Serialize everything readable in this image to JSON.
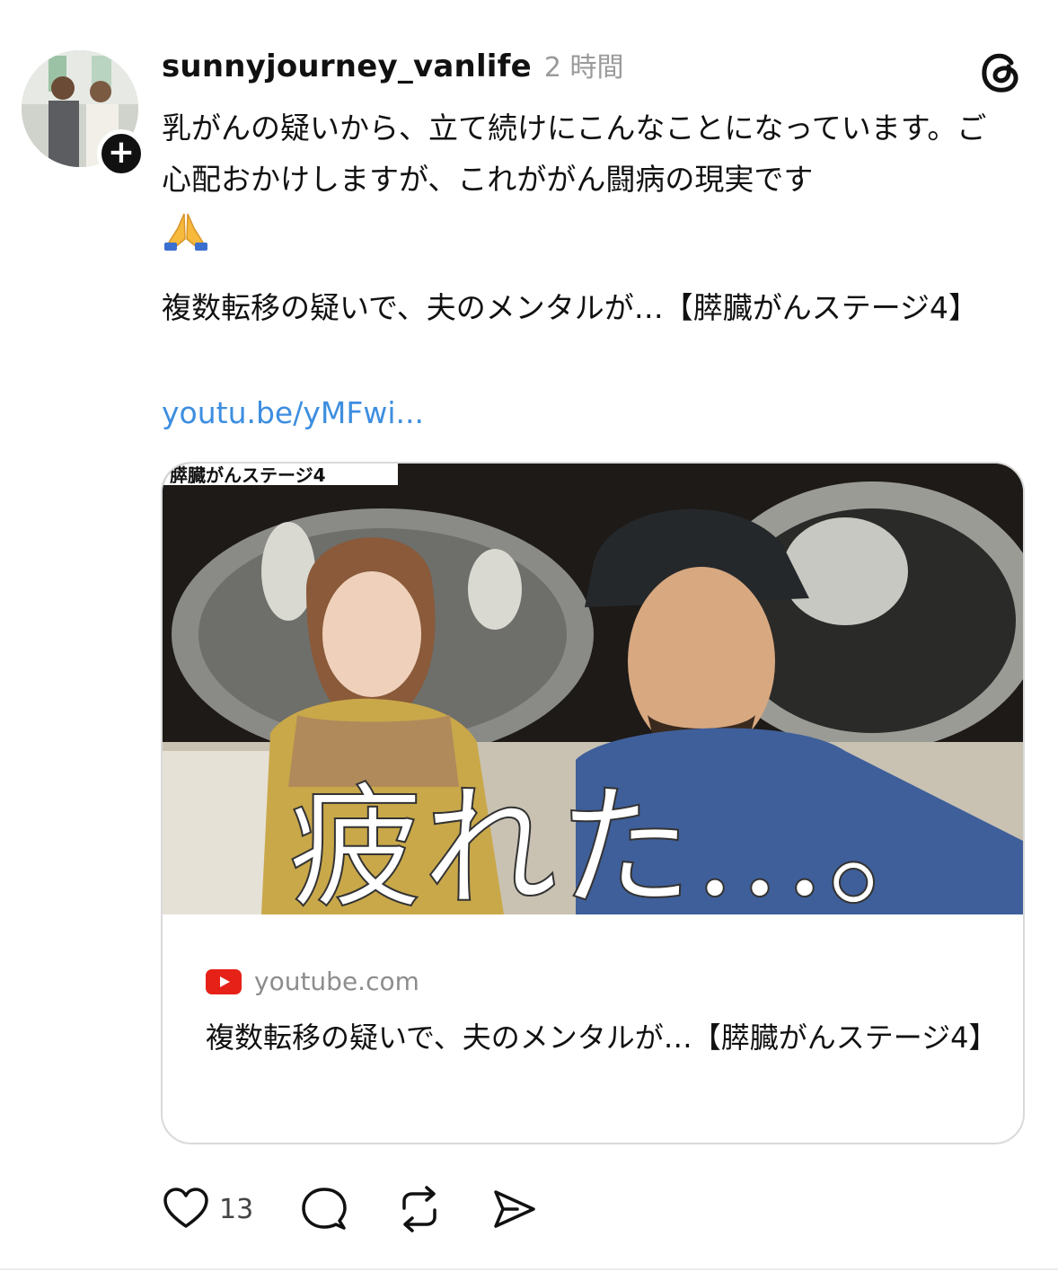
{
  "post": {
    "username": "sunnyjourney_vanlife",
    "time": "2 時間",
    "body": "乳がんの疑いから、立て続けにこんなことになっています。ご心配おかけしますが、これががん闘病の現実です",
    "title": "複数転移の疑いで、夫のメンタルが…【膵臓がんステージ4】",
    "link": "youtu.be/yMFwi..."
  },
  "card": {
    "domain": "youtube.com",
    "title": "複数転移の疑いで、夫のメンタルが…【膵臓がんステージ4】",
    "thumbnail_banner": "膵臓がんステージ4",
    "thumbnail_caption": "疲れた…。"
  },
  "actions": {
    "like_count": "13"
  },
  "colors": {
    "link": "#3d8ee0",
    "youtube_red": "#e62117",
    "meta_gray": "#9a9a9a"
  },
  "icons": [
    "plus-icon",
    "threads-logo-icon",
    "folded-hands-emoji",
    "youtube-icon",
    "heart-icon",
    "comment-icon",
    "repost-icon",
    "share-icon"
  ]
}
